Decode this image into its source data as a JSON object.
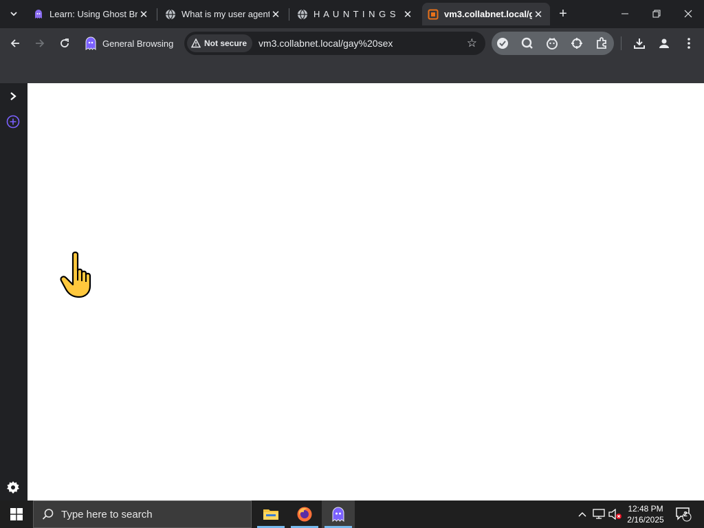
{
  "browser": {
    "tabs": [
      {
        "title": "Learn: Using Ghost Bro",
        "icon": "ghost-icon",
        "active": false
      },
      {
        "title": "What is my user agent",
        "icon": "globe-icon",
        "active": false
      },
      {
        "title": "H A U N T I N G S",
        "icon": "globe-icon",
        "active": false
      },
      {
        "title": "vm3.collabnet.local/g",
        "icon": "orange-page-icon",
        "active": true
      }
    ],
    "new_tab_label": "+",
    "profile_label": "General Browsing",
    "security_label": "Not secure",
    "url": "vm3.collabnet.local/gay%20sex",
    "accent_color": "#7b61ff"
  },
  "taskbar": {
    "search_placeholder": "Type here to search",
    "time": "12:48 PM",
    "date": "2/16/2025",
    "notification_count": "2"
  }
}
